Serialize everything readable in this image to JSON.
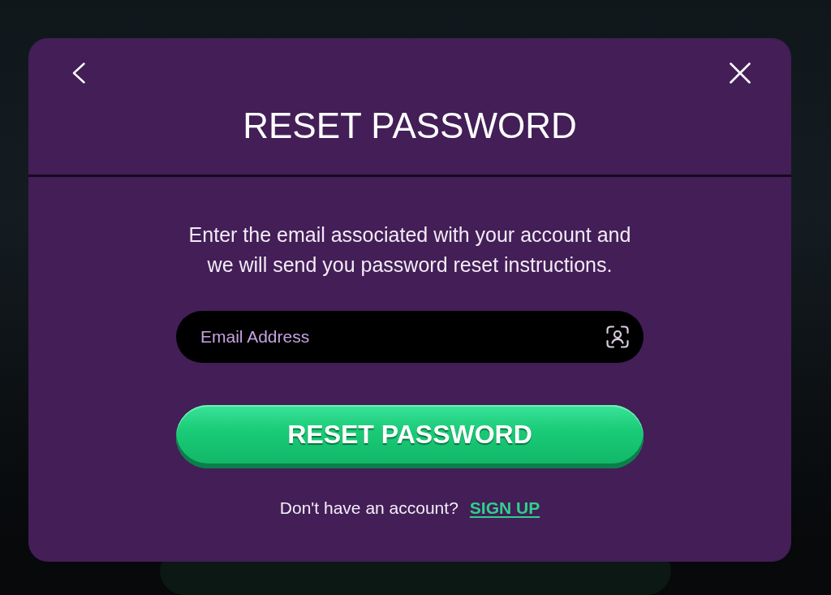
{
  "dialog": {
    "title": "RESET PASSWORD",
    "instructions": "Enter the email associated with your account and we will send you password reset instructions.",
    "email_field": {
      "placeholder": "Email Address"
    },
    "submit_button": {
      "label": "RESET PASSWORD"
    },
    "footer": {
      "prompt": "Don't have an account?",
      "link": "SIGN UP"
    }
  }
}
